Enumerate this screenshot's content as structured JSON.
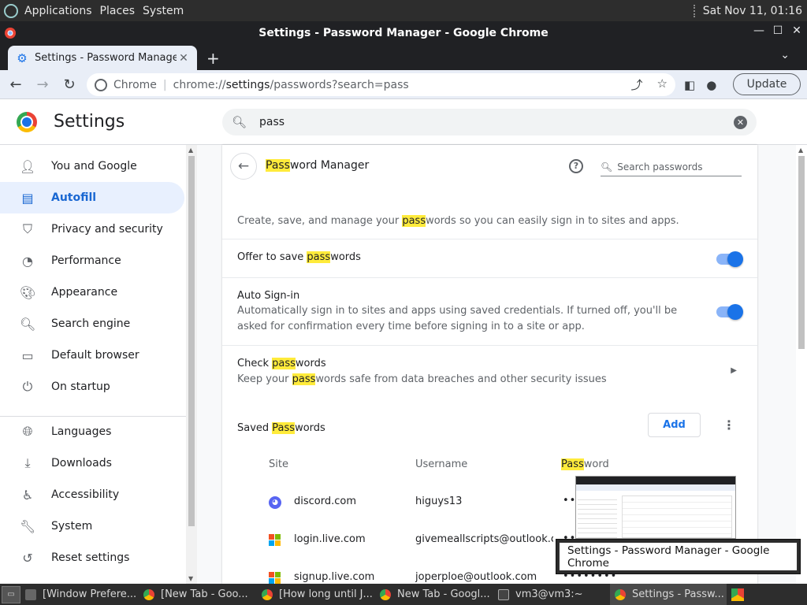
{
  "top_panel": {
    "menus": [
      "Applications",
      "Places",
      "System"
    ],
    "clock": "Sat Nov 11, 01:16"
  },
  "window": {
    "title": "Settings - Password Manager - Google Chrome",
    "controls": [
      "minimize-icon",
      "maximize-icon",
      "close-icon"
    ]
  },
  "tab": {
    "title": "Settings - Password Manager",
    "icon": "gear-icon"
  },
  "toolbar": {
    "chip": "Chrome",
    "url_prefix": "chrome://",
    "url_host": "settings",
    "url_path": "/passwords?search=pass",
    "update_label": "Update"
  },
  "settings": {
    "title": "Settings",
    "search_query": "pass"
  },
  "sidebar": {
    "items": [
      {
        "label": "You and Google",
        "icon": "person-icon"
      },
      {
        "label": "Autofill",
        "icon": "clipboard-icon",
        "active": true
      },
      {
        "label": "Privacy and security",
        "icon": "shield-icon"
      },
      {
        "label": "Performance",
        "icon": "speedometer-icon"
      },
      {
        "label": "Appearance",
        "icon": "palette-icon"
      },
      {
        "label": "Search engine",
        "icon": "search-icon"
      },
      {
        "label": "Default browser",
        "icon": "browser-icon"
      },
      {
        "label": "On startup",
        "icon": "power-icon"
      },
      {
        "label": "Languages",
        "icon": "globe-icon"
      },
      {
        "label": "Downloads",
        "icon": "download-icon"
      },
      {
        "label": "Accessibility",
        "icon": "accessibility-icon"
      },
      {
        "label": "System",
        "icon": "wrench-icon"
      },
      {
        "label": "Reset settings",
        "icon": "history-icon"
      }
    ]
  },
  "password_manager": {
    "title_highlight": "Pass",
    "title_rest": "word Manager",
    "search_placeholder": "Search passwords",
    "intro": {
      "before": "Create, save, and manage your ",
      "highlight": "pass",
      "after": "words so you can easily sign in to sites and apps."
    },
    "offer_save": {
      "before": "Offer to save ",
      "highlight": "pass",
      "after": "words",
      "enabled": true
    },
    "auto_signin": {
      "title": "Auto Sign-in",
      "desc": "Automatically sign in to sites and apps using saved credentials. If turned off, you'll be asked for confirmation every time before signing in to a site or app.",
      "enabled": true
    },
    "check": {
      "title_before": "Check ",
      "title_highlight": "pass",
      "title_after": "words",
      "desc_before": "Keep your ",
      "desc_highlight": "pass",
      "desc_after": "words safe from data breaches and other security issues"
    },
    "saved": {
      "before": "Saved ",
      "highlight": "Pass",
      "after": "words",
      "add_label": "Add"
    },
    "columns": {
      "site": "Site",
      "username": "Username",
      "password_highlight": "Pass",
      "password_rest": "word"
    },
    "rows": [
      {
        "site": "discord.com",
        "username": "higuys13",
        "password": "••••••••",
        "icon": "discord-icon"
      },
      {
        "site": "login.live.com",
        "username": "givemeallscripts@outlook.co...",
        "password": "••••••••",
        "icon": "microsoft-icon"
      },
      {
        "site": "signup.live.com",
        "username": "joperploe@outlook.com",
        "password": "••••••••",
        "icon": "microsoft-icon"
      }
    ]
  },
  "tooltip": {
    "text": "Settings - Password Manager - Google Chrome"
  },
  "taskbar": {
    "tasks": [
      {
        "label": "[Window Prefere...",
        "icon": "window-icon"
      },
      {
        "label": "[New Tab - Goo...",
        "icon": "chrome-icon"
      },
      {
        "label": "[How long until J...",
        "icon": "chrome-icon"
      },
      {
        "label": "New Tab - Googl...",
        "icon": "chrome-icon"
      },
      {
        "label": "vm3@vm3:~",
        "icon": "terminal-icon"
      },
      {
        "label": "Settings - Passw...",
        "icon": "chrome-icon",
        "active": true
      }
    ]
  }
}
